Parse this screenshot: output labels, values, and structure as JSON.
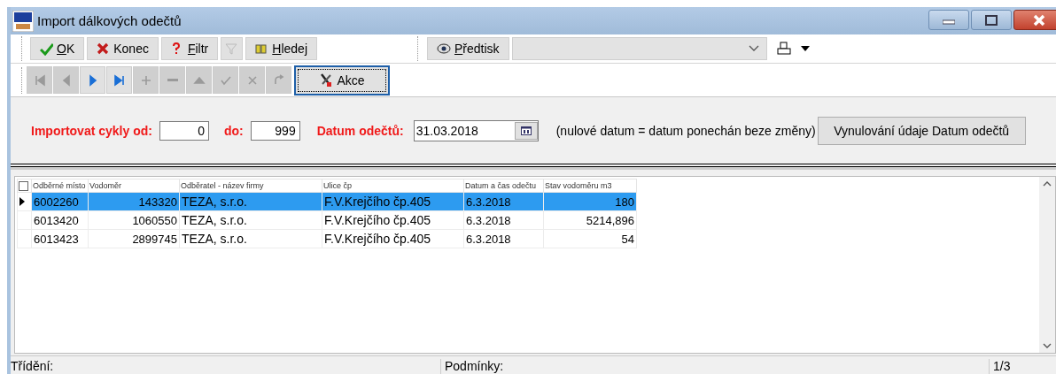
{
  "window": {
    "title": "Import dálkových odečtů"
  },
  "toolbar": {
    "buttons": [
      {
        "kind": "ok",
        "label": "OK",
        "underline_first": true,
        "disabled": false
      },
      {
        "kind": "close",
        "label": "Konec",
        "underline_first": false,
        "disabled": false
      },
      {
        "kind": "filter",
        "label": "Filtr",
        "underline_first": true,
        "disabled": false
      },
      {
        "kind": "clear-filter",
        "disabled": true
      },
      {
        "kind": "find",
        "label": "Hledej",
        "underline_first": true,
        "disabled": false
      }
    ],
    "print_button": {
      "label": "Předtisk",
      "underline_first": true
    }
  },
  "nav_buttons": [
    {
      "kind": "first",
      "disabled": true
    },
    {
      "kind": "prev",
      "disabled": true
    },
    {
      "kind": "next",
      "disabled": false
    },
    {
      "kind": "last",
      "disabled": false
    },
    {
      "kind": "add",
      "disabled": true
    },
    {
      "kind": "delete",
      "disabled": true
    },
    {
      "kind": "up",
      "disabled": true
    },
    {
      "kind": "confirm",
      "disabled": true
    },
    {
      "kind": "cancel",
      "disabled": true
    },
    {
      "kind": "refresh",
      "disabled": true
    }
  ],
  "action_button": {
    "label": "Akce"
  },
  "form": {
    "cycles_from_label": "Importovat cykly od:",
    "cycles_from": "0",
    "cycles_to_label": "do:",
    "cycles_to": "999",
    "date_label": "Datum odečtů:",
    "date": "31.03.2018",
    "note": "(nulové datum = datum ponechán beze změny)",
    "reset_button": "Vynulování údaje Datum odečtů"
  },
  "table": {
    "select_all_checked": false,
    "columns": [
      "Odběrné místo",
      "Vodoměr",
      "Odběratel - název firmy",
      "Ulice čp",
      "Datum a čas odečtu",
      "Stav vodoměru m3"
    ],
    "rows": [
      {
        "selected": true,
        "cells": [
          "6002260",
          "143320",
          "TEZA, s.r.o.",
          "F.V.Krejčího čp.405",
          "6.3.2018",
          "180"
        ]
      },
      {
        "selected": false,
        "cells": [
          "6013420",
          "1060550",
          "TEZA, s.r.o.",
          "F.V.Krejčího čp.405",
          "6.3.2018",
          "5214,896"
        ]
      },
      {
        "selected": false,
        "cells": [
          "6013423",
          "2899745",
          "TEZA, s.r.o.",
          "F.V.Krejčího čp.405",
          "6.3.2018",
          "54"
        ]
      }
    ]
  },
  "status_bar": {
    "sort_label": "Třídění:",
    "conditions_label": "Podmínky:",
    "record": "1/3"
  }
}
